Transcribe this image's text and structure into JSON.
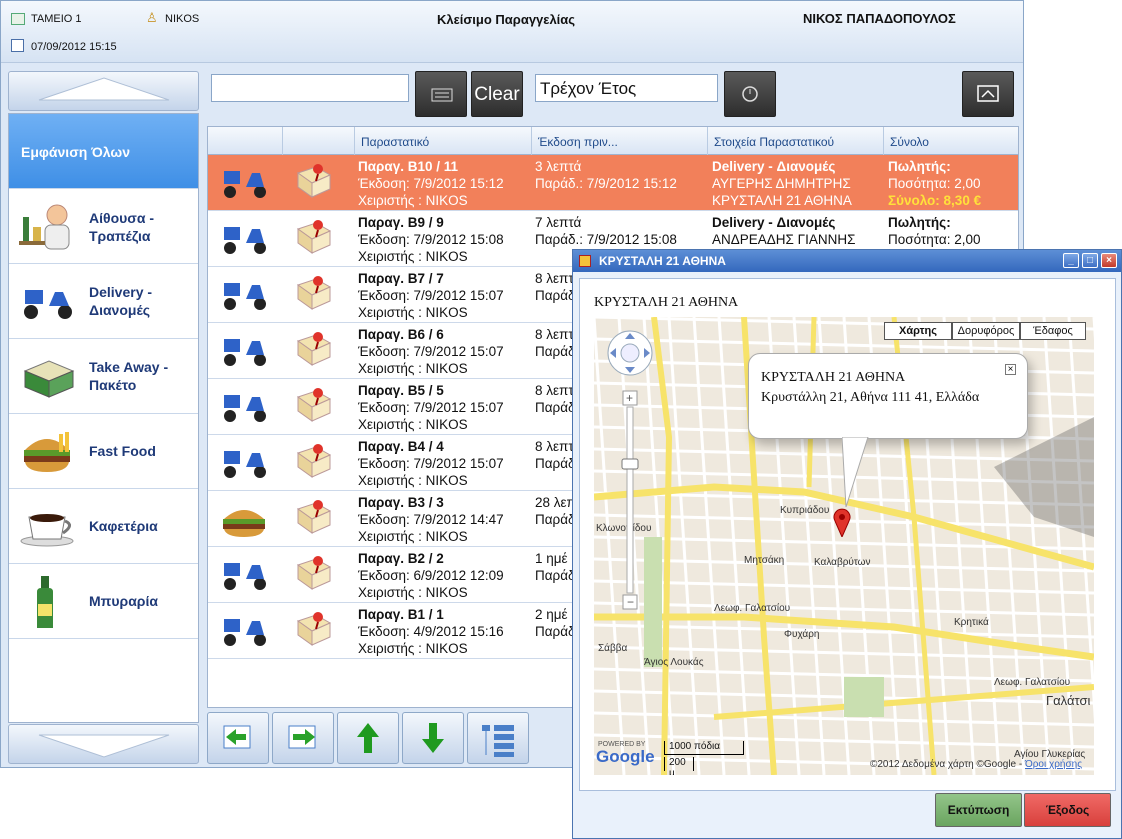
{
  "header": {
    "station": "ΤΑΜΕΙΟ 1",
    "user": "NIKOS",
    "datetime": "07/09/2012 15:15",
    "title": "Κλείσιμο Παραγγελίας",
    "customer": "ΝΙΚΟΣ ΠΑΠΑΔΟΠΟΥΛΟΣ"
  },
  "toolbar": {
    "search_value": "",
    "clear_label": "Clear",
    "period_value": "Τρέχον Έτος"
  },
  "categories": [
    {
      "label": "Εμφάνιση Όλων",
      "icon": "all"
    },
    {
      "label": "Αίθουσα - Τραπέζια",
      "icon": "waiter-icon"
    },
    {
      "label": "Delivery - Διανομές",
      "icon": "scooter-icon"
    },
    {
      "label": "Take Away - Πακέτο",
      "icon": "package-icon"
    },
    {
      "label": "Fast Food",
      "icon": "burger-icon"
    },
    {
      "label": "Καφετέρια",
      "icon": "coffee-icon"
    },
    {
      "label": "Μπυραρία",
      "icon": "beer-icon"
    }
  ],
  "grid": {
    "columns": [
      "",
      "",
      "Παραστατικό",
      "Έκδοση πριν...",
      "Στοιχεία Παραστατικού",
      "Σύνολο"
    ],
    "rows": [
      {
        "doc": "Παραγ. Β10 / 11",
        "issued": "Έκδοση: 7/9/2012 15:12",
        "cashier": "Χειριστής : NIKOS",
        "ago": "3 λεπτά",
        "delivered": "Παράδ.: 7/9/2012 15:12",
        "type": "Delivery - Διανομές",
        "name": "ΑΥΓΕΡΗΣ ΔΗΜΗΤΡΗΣ",
        "address": "ΚΡΥΣΤΑΛΗ 21 ΑΘΗΝΑ",
        "seller": "Πωλητής:",
        "qty": "Ποσότητα: 2,00",
        "total": "Σύνολο: 8,30 €",
        "icon": "scooter-icon",
        "selected": true
      },
      {
        "doc": "Παραγ. Β9 / 9",
        "issued": "Έκδοση: 7/9/2012 15:08",
        "cashier": "Χειριστής : NIKOS",
        "ago": "7 λεπτά",
        "delivered": "Παράδ.: 7/9/2012 15:08",
        "type": "Delivery - Διανομές",
        "name": "ΑΝΔΡΕΑΔΗΣ ΓΙΑΝΝΗΣ",
        "address": "",
        "seller": "Πωλητής:",
        "qty": "Ποσότητα: 2,00",
        "total": "",
        "icon": "scooter-icon"
      },
      {
        "doc": "Παραγ. Β7 / 7",
        "issued": "Έκδοση: 7/9/2012 15:07",
        "cashier": "Χειριστής : NIKOS",
        "ago": "8 λεπτ",
        "delivered": "Παράδ",
        "icon": "scooter-icon"
      },
      {
        "doc": "Παραγ. Β6 / 6",
        "issued": "Έκδοση: 7/9/2012 15:07",
        "cashier": "Χειριστής : NIKOS",
        "ago": "8 λεπτ",
        "delivered": "Παράδ",
        "icon": "scooter-icon"
      },
      {
        "doc": "Παραγ. Β5 / 5",
        "issued": "Έκδοση: 7/9/2012 15:07",
        "cashier": "Χειριστής : NIKOS",
        "ago": "8 λεπτ",
        "delivered": "Παράδ",
        "icon": "scooter-icon"
      },
      {
        "doc": "Παραγ. Β4 / 4",
        "issued": "Έκδοση: 7/9/2012 15:07",
        "cashier": "Χειριστής : NIKOS",
        "ago": "8 λεπτ",
        "delivered": "Παράδ",
        "icon": "scooter-icon"
      },
      {
        "doc": "Παραγ. Β3 / 3",
        "issued": "Έκδοση: 7/9/2012 14:47",
        "cashier": "Χειριστής : NIKOS",
        "ago": "28 λεπτ",
        "delivered": "Παράδ",
        "icon": "burger-icon"
      },
      {
        "doc": "Παραγ. Β2 / 2",
        "issued": "Έκδοση: 6/9/2012 12:09",
        "cashier": "Χειριστής : NIKOS",
        "ago": "1 ημέ",
        "delivered": "Παράδ",
        "icon": "scooter-icon"
      },
      {
        "doc": "Παραγ. Β1 / 1",
        "issued": "Έκδοση: 4/9/2012 15:16",
        "cashier": "Χειριστής : NIKOS",
        "ago": "2 ημέ",
        "delivered": "Παράδ",
        "icon": "scooter-icon"
      }
    ]
  },
  "map_window": {
    "title": "ΚΡΥΣΤΑΛΗ 21 ΑΘΗΝΑ",
    "heading": "ΚΡΥΣΤΑΛΗ 21 ΑΘΗΝΑ",
    "map_types": [
      "Χάρτης",
      "Δορυφόρος",
      "Έδαφος"
    ],
    "bubble_title": "ΚΡΥΣΤΑΛΗ 21 ΑΘΗΝΑ",
    "bubble_address": "Κρυστάλλη 21, Αθήνα 111 41, Ελλάδα",
    "scale_top": "1000 πόδια",
    "scale_bottom": "200 μ",
    "copyright": "©2012 Δεδομένα χάρτη ©Google -",
    "terms": "Όροι χρήσης",
    "powered_by": "POWERED BY",
    "google": "Google",
    "streets": [
      "Κυπριάδου",
      "Λεωφ. Γαλατσίου",
      "Κλωνοπίδου",
      "Σάββα",
      "Άγιος Λουκάς",
      "Κρητικά",
      "Γαλάτσι",
      "Λεωφ. Γαλατσίου",
      "Φυχάρη",
      "Καλαβρύτων",
      "Μητσάκη",
      "Αγίου Γλυκερίας"
    ],
    "print_label": "Εκτύπωση",
    "exit_label": "Έξοδος"
  },
  "colors": {
    "selected_row": "#f2805a",
    "selected_category": "#3f8fe6",
    "print_btn": "#7fb577",
    "exit_btn": "#e0504e"
  }
}
